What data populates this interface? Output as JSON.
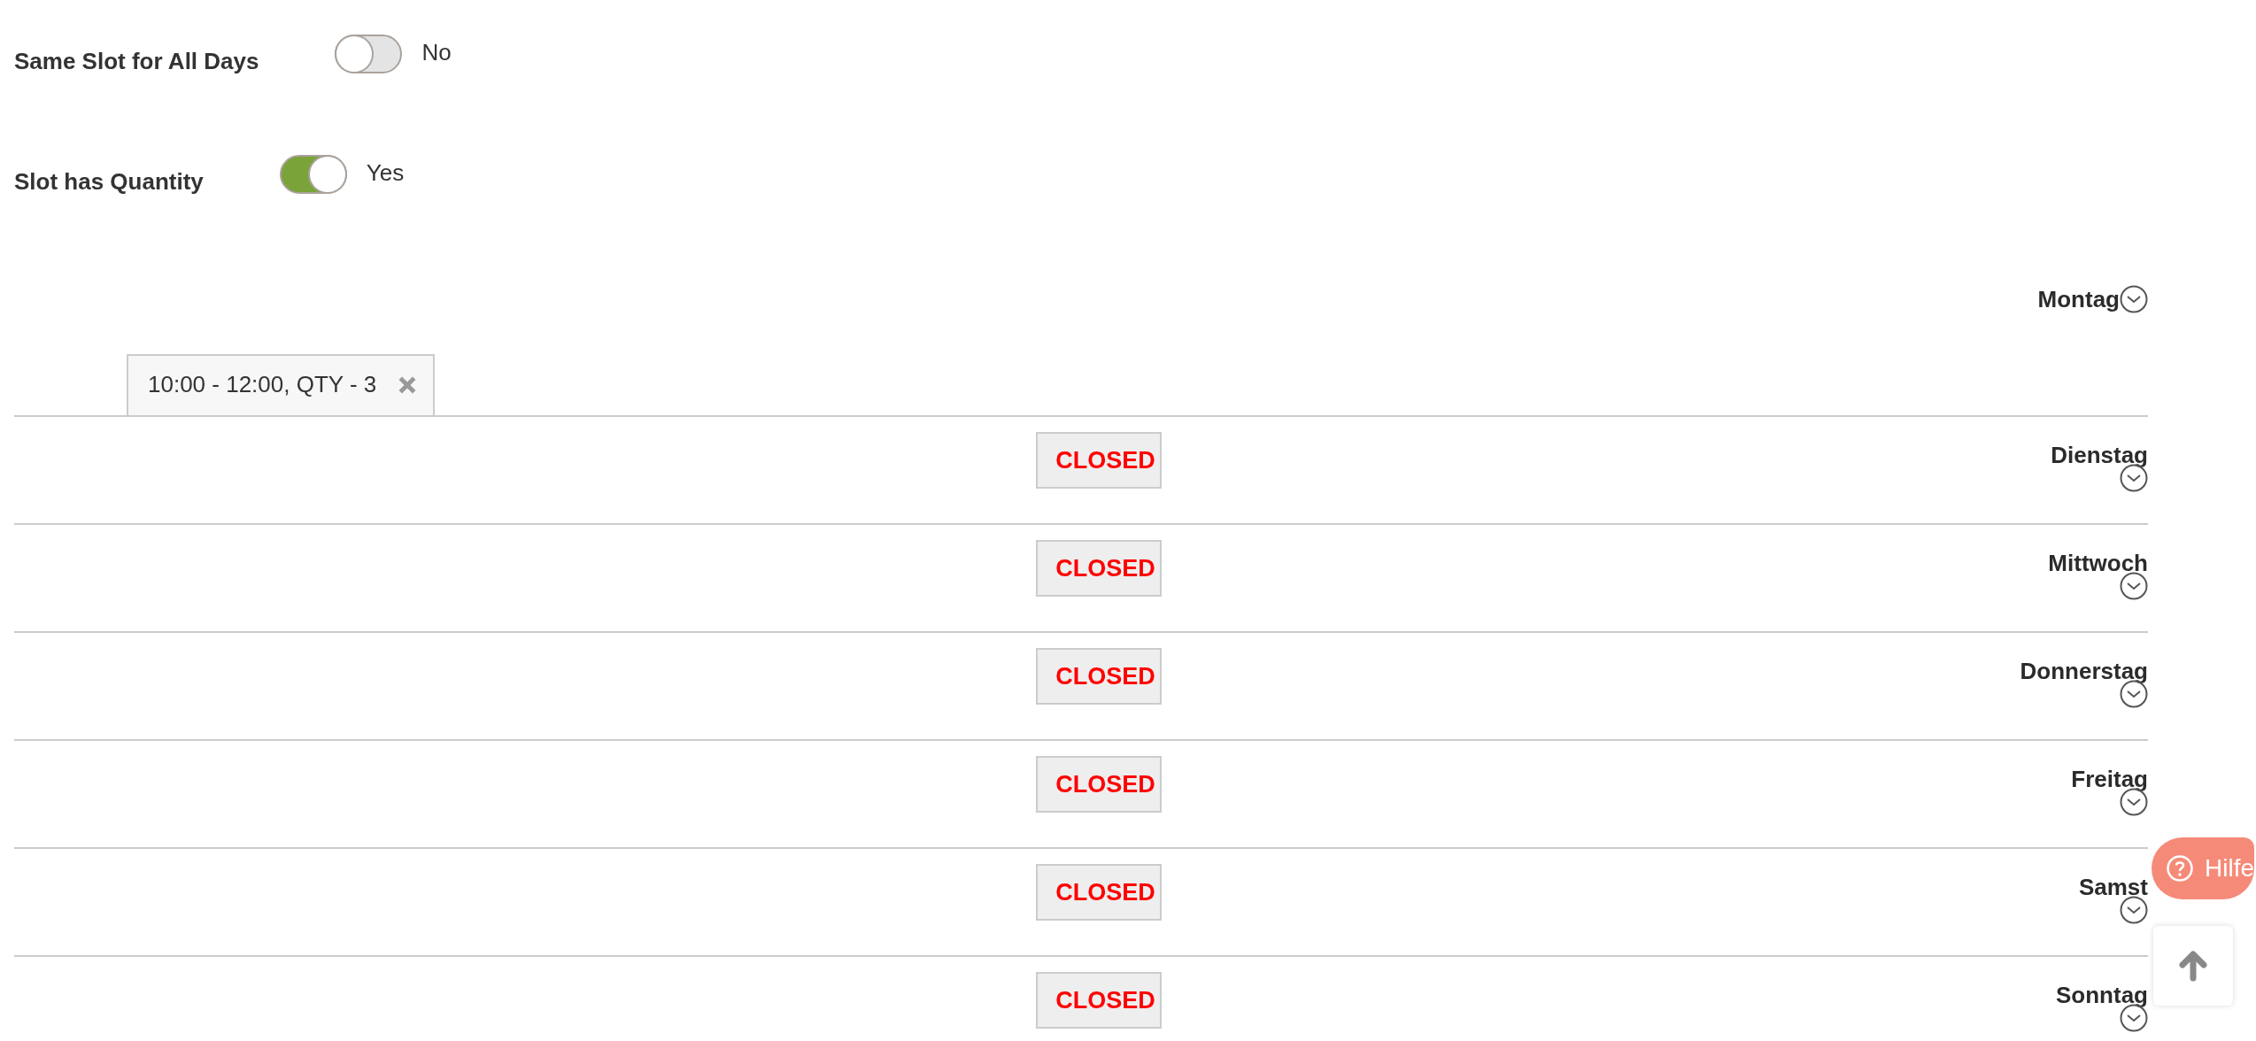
{
  "settings": [
    {
      "label": "Same Slot for All Days",
      "on": false,
      "value": "No"
    },
    {
      "label": "Slot has Quantity",
      "on": true,
      "value": "Yes"
    }
  ],
  "days": [
    {
      "name": "Montag",
      "kind": "slots",
      "slots": [
        "10:00 - 12:00, QTY - 3"
      ]
    },
    {
      "name": "Dienstag",
      "kind": "closed",
      "status": "CLOSED"
    },
    {
      "name": "Mittwoch",
      "kind": "closed",
      "status": "CLOSED"
    },
    {
      "name": "Donnerstag",
      "kind": "closed",
      "status": "CLOSED"
    },
    {
      "name": "Freitag",
      "kind": "closed",
      "status": "CLOSED"
    },
    {
      "name": "Samst",
      "kind": "closed",
      "status": "CLOSED"
    },
    {
      "name": "Sonntag",
      "kind": "closed",
      "status": "CLOSED"
    }
  ],
  "help_button": {
    "label": "Hilfe"
  }
}
